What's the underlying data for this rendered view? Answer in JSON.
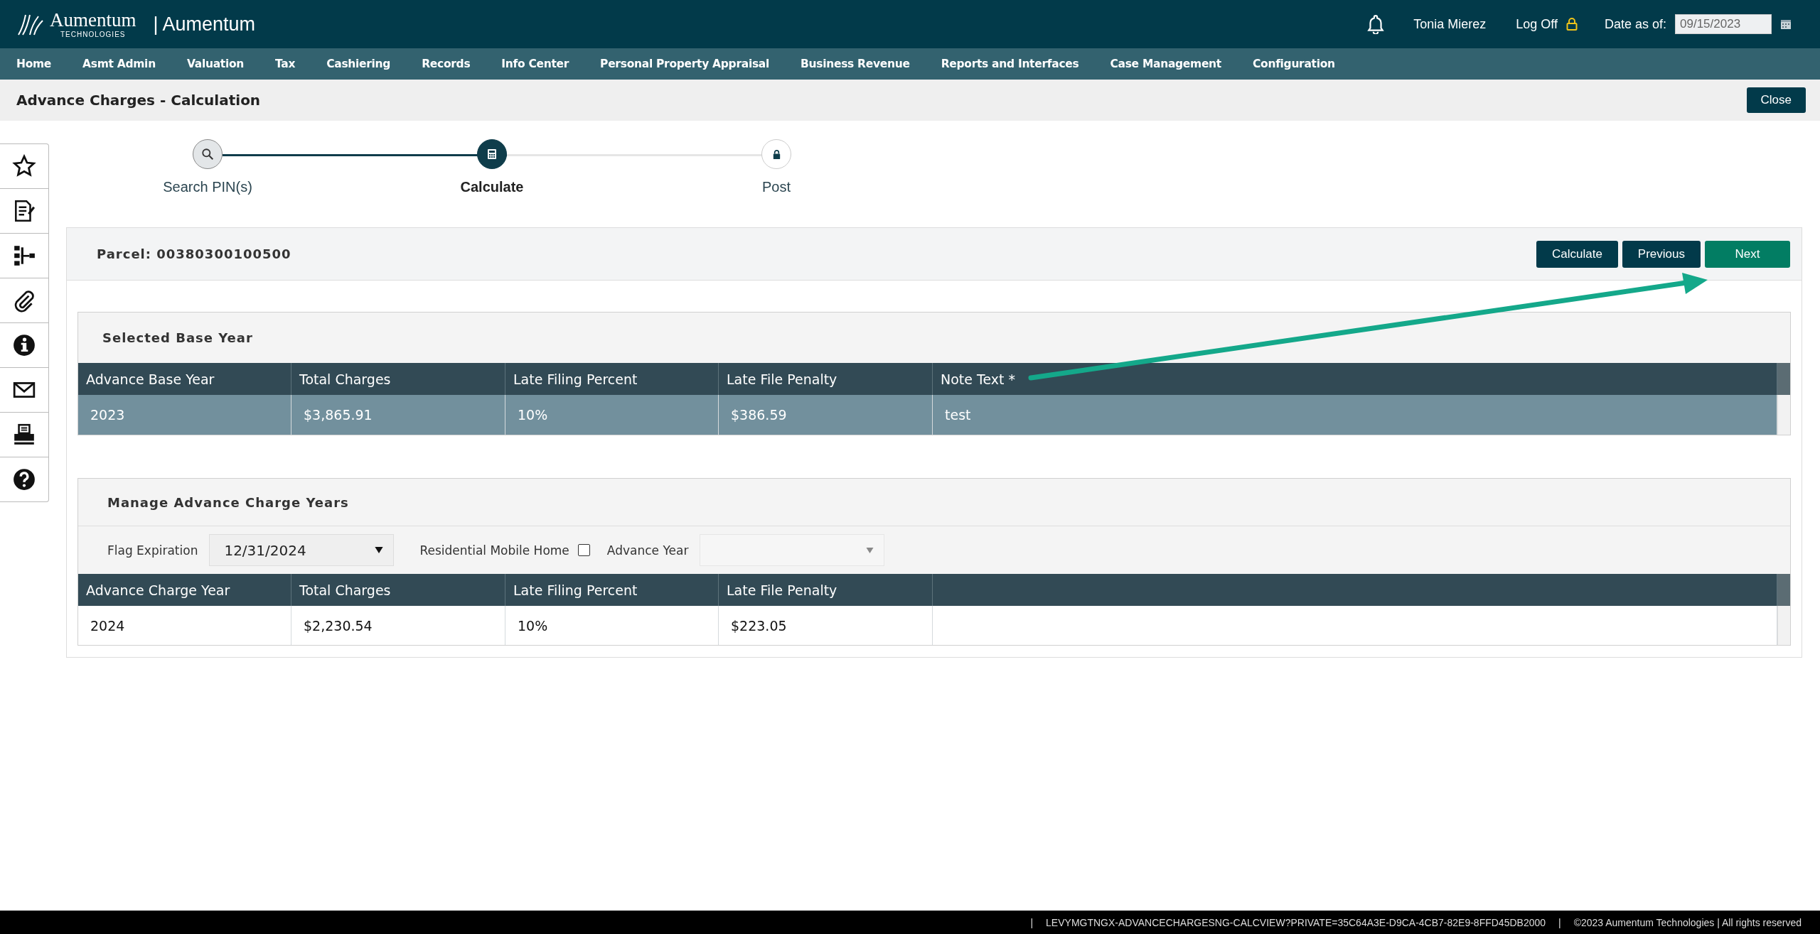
{
  "header": {
    "logo": {
      "name": "Aumentum",
      "tagline": "TECHNOLOGIES"
    },
    "app_title": "| Aumentum",
    "user": "Tonia Mierez",
    "log_off": "Log Off",
    "date_label": "Date as of:",
    "date_value": "09/15/2023"
  },
  "nav": [
    "Home",
    "Asmt Admin",
    "Valuation",
    "Tax",
    "Cashiering",
    "Records",
    "Info Center",
    "Personal Property Appraisal",
    "Business Revenue",
    "Reports and Interfaces",
    "Case Management",
    "Configuration"
  ],
  "page_title": "Advance Charges - Calculation",
  "close_button": "Close",
  "steps": [
    {
      "label": "Search PIN(s)",
      "completed": true,
      "selected": false
    },
    {
      "label": "Calculate",
      "completed": false,
      "selected": true
    },
    {
      "label": "Post",
      "completed": false,
      "selected": false
    }
  ],
  "parcel": {
    "label": "Parcel: 00380300100500",
    "buttons": [
      {
        "label": "Calculate",
        "kind": "primary"
      },
      {
        "label": "Previous",
        "kind": "primary"
      },
      {
        "label": "Next",
        "kind": "accent"
      }
    ]
  },
  "base_year": {
    "title": "Selected Base Year",
    "columns": [
      "Advance Base Year",
      "Total Charges",
      "Late Filing Percent",
      "Late File Penalty",
      "Note Text *"
    ],
    "rows": [
      {
        "cells": [
          "2023",
          "$3,865.91",
          "10%",
          "$386.59",
          "test"
        ],
        "selected": true
      }
    ]
  },
  "manage": {
    "title": "Manage Advance Charge Years",
    "flag_label": "Flag Expiration",
    "flag_value": "12/31/2024",
    "mobile_label": "Residential Mobile Home",
    "mobile_checked": false,
    "year_label": "Advance Year",
    "columns": [
      "Advance Charge Year",
      "Total Charges",
      "Late Filing Percent",
      "Late File Penalty"
    ],
    "rows": [
      {
        "cells": [
          "2024",
          "$2,230.54",
          "10%",
          "$223.05"
        ],
        "selected": false
      }
    ]
  },
  "footer": [
    "|",
    "LEVYMGTNGX-ADVANCECHARGESNG-CALCVIEW?PRIVATE=35C64A3E-D9CA-4CB7-82E9-8FFD45DB2000",
    "|",
    "©2023 Aumentum Technologies | All rights reserved"
  ]
}
